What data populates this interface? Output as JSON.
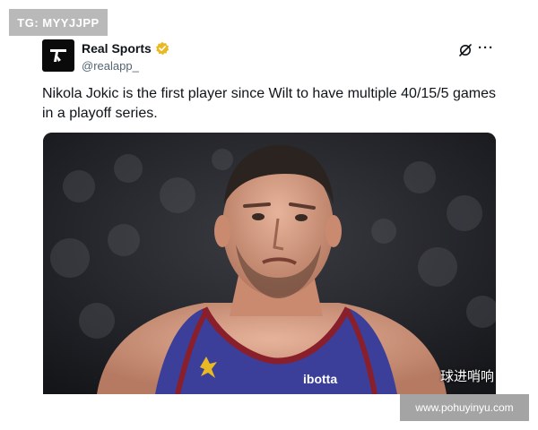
{
  "corner_badge": "TG: MYYJJPP",
  "account": {
    "display_name": "Real Sports",
    "handle": "@realapp_",
    "verified_color": "#e8b923"
  },
  "actions": {
    "grok_icon": "grok-icon",
    "more_label": "···"
  },
  "tweet": {
    "text_line1": "Nikola Jokic is the first player since Wilt to have multiple 40/15/5 games",
    "text_line2": "in a playoff series."
  },
  "media": {
    "caption": "球进哨响",
    "jersey_text": "ibotta",
    "jersey_color": "#3b3f9a",
    "trim_color": "#8a1f2c"
  },
  "watermark": "www.pohuyinyu.com"
}
